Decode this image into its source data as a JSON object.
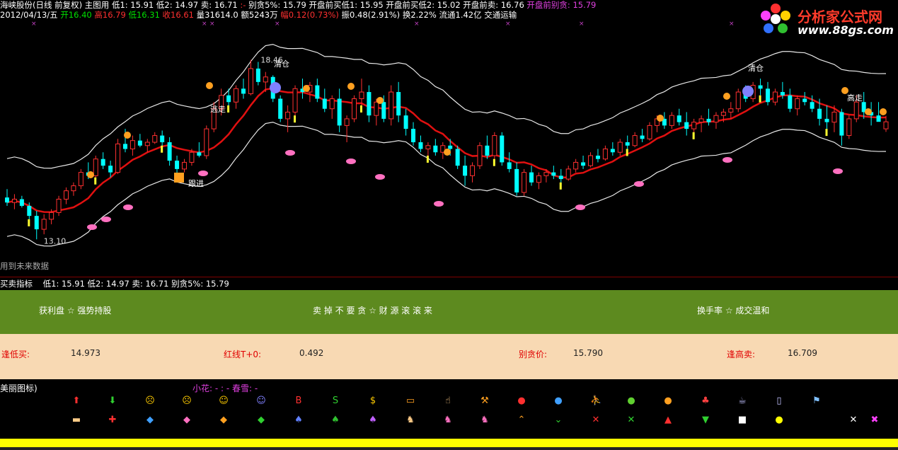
{
  "header": {
    "line1": [
      {
        "t": "海峡股份(日线 前复权) 主图用  ",
        "c": "w"
      },
      {
        "t": "低1: 15.91  低2: 14.97  卖: 16.71",
        "c": "w"
      },
      {
        "t": "  :-  ",
        "c": "r"
      },
      {
        "t": "     别贪5%: 15.79     开盘前买低1: 15.95  开盘前买低2: 15.02  开盘前卖: 16.76  ",
        "c": "w"
      },
      {
        "t": "开盘前别贪: 15.79",
        "c": "m"
      }
    ],
    "line2": [
      {
        "t": "2012/04/13/五 ",
        "c": "w"
      },
      {
        "t": "开16.40 ",
        "c": "g"
      },
      {
        "t": "高16.79 ",
        "c": "r"
      },
      {
        "t": "低16.31 ",
        "c": "g"
      },
      {
        "t": "收16.61 ",
        "c": "r"
      },
      {
        "t": "量31614.0 额5243万 ",
        "c": "w"
      },
      {
        "t": "幅0.12(0.73%) ",
        "c": "r"
      },
      {
        "t": "振0.48(2.91%) 换2.22% 流通1.42亿 交通运输",
        "c": "w"
      }
    ]
  },
  "logo": {
    "name": "分析家公式网",
    "url": "www.88gs.com"
  },
  "chart_data": {
    "type": "candlestick",
    "annotations": {
      "high_price": "18.46",
      "low_price": "13.10",
      "labels": [
        "清仓",
        "清仓",
        "逃走",
        "高走",
        "跟进"
      ]
    },
    "candles": [
      [
        14.35,
        14.6,
        14.1,
        14.2
      ],
      [
        14.2,
        14.45,
        14.0,
        14.3
      ],
      [
        14.3,
        14.4,
        14.05,
        14.1
      ],
      [
        14.1,
        14.2,
        13.7,
        13.8
      ],
      [
        13.8,
        13.95,
        13.1,
        13.4
      ],
      [
        13.4,
        13.85,
        13.25,
        13.7
      ],
      [
        13.7,
        14.0,
        13.55,
        13.9
      ],
      [
        13.9,
        14.4,
        13.8,
        14.3
      ],
      [
        14.3,
        14.65,
        14.15,
        14.55
      ],
      [
        14.55,
        14.8,
        14.4,
        14.7
      ],
      [
        14.7,
        15.2,
        14.6,
        15.1
      ],
      [
        15.1,
        15.4,
        14.9,
        15.0
      ],
      [
        15.0,
        15.6,
        14.95,
        15.5
      ],
      [
        15.5,
        15.7,
        15.2,
        15.3
      ],
      [
        15.3,
        15.45,
        14.95,
        15.1
      ],
      [
        15.1,
        16.1,
        15.05,
        15.95
      ],
      [
        15.95,
        16.4,
        15.7,
        15.8
      ],
      [
        15.8,
        16.2,
        15.6,
        16.05
      ],
      [
        16.05,
        16.25,
        15.85,
        15.9
      ],
      [
        15.9,
        16.1,
        15.7,
        16.0
      ],
      [
        16.0,
        16.3,
        15.95,
        16.2
      ],
      [
        16.2,
        16.35,
        15.9,
        16.0
      ],
      [
        16.0,
        16.15,
        15.3,
        15.45
      ],
      [
        15.45,
        15.6,
        15.05,
        15.2
      ],
      [
        15.2,
        15.5,
        15.1,
        15.4
      ],
      [
        15.4,
        15.8,
        15.3,
        15.7
      ],
      [
        15.7,
        16.0,
        15.55,
        15.6
      ],
      [
        15.6,
        16.5,
        15.5,
        16.4
      ],
      [
        16.4,
        17.2,
        16.3,
        17.0
      ],
      [
        17.0,
        17.6,
        16.8,
        17.4
      ],
      [
        17.4,
        17.6,
        17.1,
        17.2
      ],
      [
        17.2,
        17.7,
        17.0,
        17.6
      ],
      [
        17.6,
        17.9,
        17.3,
        17.45
      ],
      [
        17.45,
        18.46,
        17.4,
        18.2
      ],
      [
        18.2,
        18.4,
        17.7,
        17.8
      ],
      [
        17.8,
        18.1,
        17.5,
        17.95
      ],
      [
        17.95,
        18.0,
        17.2,
        17.3
      ],
      [
        17.3,
        17.4,
        16.6,
        16.7
      ],
      [
        16.7,
        17.1,
        16.3,
        16.9
      ],
      [
        16.9,
        17.7,
        16.8,
        17.6
      ],
      [
        17.6,
        17.9,
        17.3,
        17.5
      ],
      [
        17.5,
        17.8,
        17.2,
        17.7
      ],
      [
        17.7,
        17.9,
        17.2,
        17.3
      ],
      [
        17.3,
        17.6,
        16.9,
        17.0
      ],
      [
        17.0,
        17.4,
        16.7,
        17.3
      ],
      [
        17.3,
        17.6,
        16.3,
        16.5
      ],
      [
        16.5,
        16.8,
        16.0,
        16.7
      ],
      [
        16.7,
        17.4,
        16.6,
        17.3
      ],
      [
        17.3,
        17.9,
        17.1,
        17.5
      ],
      [
        17.5,
        17.7,
        16.6,
        16.8
      ],
      [
        16.8,
        17.3,
        16.5,
        17.2
      ],
      [
        17.2,
        17.4,
        16.6,
        16.7
      ],
      [
        16.7,
        17.7,
        16.5,
        17.5
      ],
      [
        17.5,
        17.8,
        16.6,
        16.8
      ],
      [
        16.8,
        17.0,
        16.2,
        16.4
      ],
      [
        16.4,
        16.6,
        15.9,
        16.0
      ],
      [
        16.0,
        16.2,
        15.7,
        15.8
      ],
      [
        15.8,
        16.0,
        15.6,
        15.9
      ],
      [
        15.9,
        16.1,
        15.6,
        15.7
      ],
      [
        15.7,
        16.0,
        15.5,
        15.9
      ],
      [
        15.9,
        16.1,
        15.6,
        15.8
      ],
      [
        15.8,
        15.9,
        15.2,
        15.3
      ],
      [
        15.3,
        15.6,
        14.7,
        15.0
      ],
      [
        15.0,
        15.4,
        14.8,
        15.3
      ],
      [
        15.3,
        16.0,
        15.2,
        15.9
      ],
      [
        15.9,
        16.2,
        15.5,
        15.6
      ],
      [
        15.6,
        16.3,
        15.5,
        16.2
      ],
      [
        16.2,
        16.3,
        15.3,
        15.4
      ],
      [
        15.4,
        15.7,
        15.1,
        15.2
      ],
      [
        15.2,
        15.4,
        14.4,
        14.5
      ],
      [
        14.5,
        15.2,
        14.4,
        15.1
      ],
      [
        15.1,
        15.3,
        14.7,
        14.8
      ],
      [
        14.8,
        15.1,
        14.6,
        15.0
      ],
      [
        15.0,
        15.2,
        14.8,
        15.1
      ],
      [
        15.1,
        15.3,
        14.9,
        15.0
      ],
      [
        15.0,
        15.2,
        14.8,
        14.9
      ],
      [
        14.9,
        15.3,
        14.85,
        15.2
      ],
      [
        15.2,
        15.5,
        15.1,
        15.4
      ],
      [
        15.4,
        15.6,
        15.2,
        15.3
      ],
      [
        15.3,
        15.7,
        15.25,
        15.6
      ],
      [
        15.6,
        15.8,
        15.4,
        15.5
      ],
      [
        15.5,
        15.9,
        15.45,
        15.8
      ],
      [
        15.8,
        16.0,
        15.6,
        15.7
      ],
      [
        15.7,
        16.1,
        15.6,
        16.0
      ],
      [
        16.0,
        16.2,
        15.8,
        15.9
      ],
      [
        15.9,
        16.3,
        15.85,
        16.2
      ],
      [
        16.2,
        16.4,
        16.0,
        16.1
      ],
      [
        16.1,
        16.6,
        16.05,
        16.5
      ],
      [
        16.5,
        16.8,
        16.3,
        16.7
      ],
      [
        16.7,
        16.9,
        16.4,
        16.5
      ],
      [
        16.5,
        16.9,
        16.4,
        16.8
      ],
      [
        16.8,
        17.0,
        16.5,
        16.6
      ],
      [
        16.6,
        16.9,
        16.2,
        16.4
      ],
      [
        16.4,
        16.7,
        16.3,
        16.6
      ],
      [
        16.6,
        16.8,
        16.3,
        16.7
      ],
      [
        16.7,
        17.0,
        16.5,
        16.6
      ],
      [
        16.6,
        16.9,
        16.4,
        16.8
      ],
      [
        16.8,
        17.0,
        16.6,
        16.9
      ],
      [
        16.9,
        17.2,
        16.7,
        17.0
      ],
      [
        17.0,
        17.6,
        16.9,
        17.5
      ],
      [
        17.5,
        17.7,
        17.2,
        17.3
      ],
      [
        17.3,
        17.8,
        17.2,
        17.7
      ],
      [
        17.7,
        17.9,
        17.4,
        17.6
      ],
      [
        17.6,
        17.8,
        17.1,
        17.2
      ],
      [
        17.2,
        17.6,
        17.1,
        17.5
      ],
      [
        17.5,
        17.8,
        17.3,
        17.4
      ],
      [
        17.4,
        17.6,
        16.9,
        17.0
      ],
      [
        17.0,
        17.4,
        16.8,
        17.3
      ],
      [
        17.3,
        17.5,
        17.1,
        17.2
      ],
      [
        17.2,
        17.4,
        16.9,
        17.0
      ],
      [
        17.0,
        17.3,
        16.5,
        16.7
      ],
      [
        16.7,
        17.1,
        16.4,
        16.6
      ],
      [
        16.6,
        17.1,
        16.3,
        16.9
      ],
      [
        16.9,
        17.0,
        15.9,
        16.2
      ],
      [
        16.2,
        16.8,
        16.1,
        16.7
      ],
      [
        16.7,
        17.4,
        16.6,
        17.2
      ],
      [
        17.2,
        17.5,
        16.7,
        16.9
      ],
      [
        16.9,
        17.2,
        16.5,
        16.8
      ],
      [
        16.8,
        17.2,
        16.7,
        16.61
      ],
      [
        16.4,
        16.79,
        16.31,
        16.61
      ]
    ]
  },
  "future_note": "用到未来数据",
  "indicator_row": {
    "name": "买卖指标",
    "values": "低1: 15.91  低2: 14.97  卖: 16.71  别贪5%: 15.79"
  },
  "green_band": {
    "left": "获利盘 ☆ 强势持股",
    "center": "卖 掉 不 要 贪 ☆ 财 源 滚 滚 来",
    "right": "换手率 ☆ 成交温和"
  },
  "tan_band": {
    "items": [
      {
        "label": "逢低买:",
        "value": "14.973"
      },
      {
        "label": "红线T+0:",
        "value": "0.492"
      },
      {
        "label": "别贪价:",
        "value": "15.790"
      },
      {
        "label": "逢高卖:",
        "value": "16.709"
      }
    ]
  },
  "icons_panel": {
    "title": "美丽图标)",
    "sub_label": "小花: - : - 春雪: -",
    "row1": [
      "up-arrow-icon",
      "down-arrow-icon",
      "face-scared-icon",
      "face-sad-icon",
      "face-smile-icon",
      "face-purple-icon",
      "letter-b-icon",
      "letter-s-icon",
      "money-bag-icon",
      "sign-icon",
      "hand-icon",
      "hammer-icon",
      "red-ball-icon",
      "blue-ball-icon",
      "runner-icon",
      "green-apple-icon",
      "orange-icon",
      "cherries-icon",
      "cup-icon",
      "phone-icon",
      "flag-icon"
    ],
    "row2": [
      "cake-icon",
      "cross-icon",
      "blue-gem-icon",
      "pink-gem-icon",
      "orange-gem-icon",
      "green-gem-icon",
      "blue-bat-icon",
      "green-bat-icon",
      "purple-bat-icon",
      "tan-figure-icon",
      "pink-figure-icon",
      "pink-figure2-icon",
      "up-chevron-icon",
      "down-chevron-icon",
      "red-x-icon",
      "green-x-icon",
      "red-triangle-icon",
      "green-triangle-icon",
      "white-square-icon",
      "yellow-circle-icon",
      "white-x-icon",
      "pink-x-icon"
    ]
  }
}
